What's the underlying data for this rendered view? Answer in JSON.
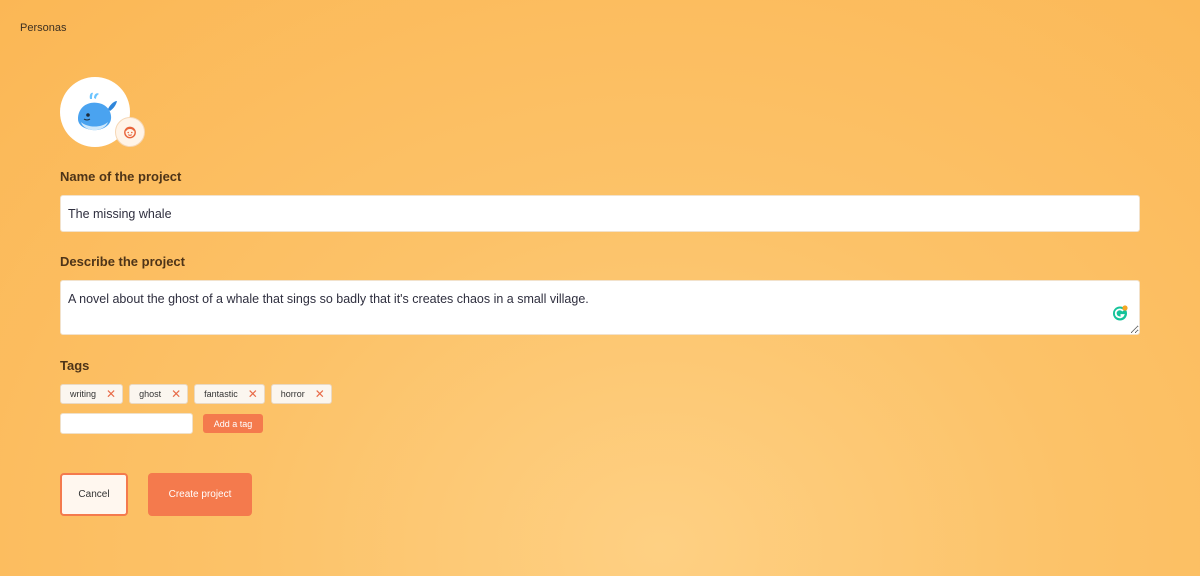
{
  "breadcrumb": {
    "label": "Personas"
  },
  "avatar": {
    "icon": "whale-icon",
    "edit_icon": "face-icon"
  },
  "form": {
    "name_label": "Name of the project",
    "name_value": "The missing whale",
    "description_label": "Describe the project",
    "description_value": "A novel about the ghost of a whale that sings so badly that it's creates chaos in a small village.",
    "tags_label": "Tags",
    "tags": [
      {
        "label": "writing"
      },
      {
        "label": "ghost"
      },
      {
        "label": "fantastic"
      },
      {
        "label": "horror"
      }
    ],
    "tag_remove_symbol": "✕",
    "new_tag_value": "",
    "add_tag_label": "Add a tag"
  },
  "actions": {
    "cancel_label": "Cancel",
    "create_label": "Create project"
  },
  "colors": {
    "accent": "#f47a4d",
    "background_from": "#fbb755",
    "background_to": "#fed083"
  }
}
